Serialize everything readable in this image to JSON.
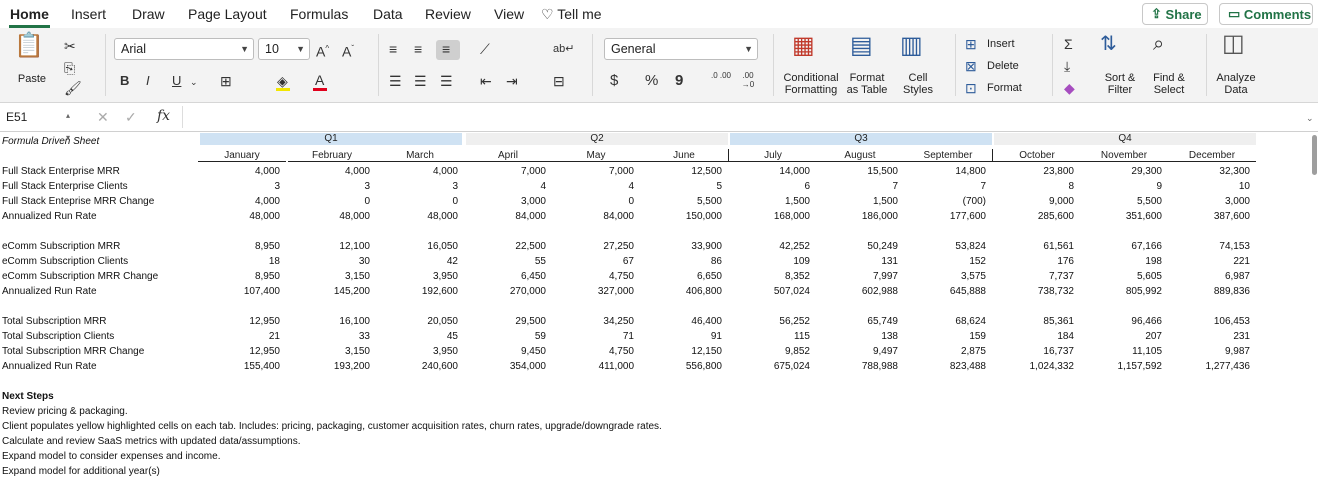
{
  "ribbon_tabs": [
    "Home",
    "Insert",
    "Draw",
    "Page Layout",
    "Formulas",
    "Data",
    "Review",
    "View",
    "Tell me"
  ],
  "share_label": "Share",
  "comments_label": "Comments",
  "clipboard": {
    "paste_label": "Paste"
  },
  "font": {
    "name": "Arial",
    "size": "10",
    "bold": "B",
    "italic": "I",
    "underline": "U"
  },
  "number": {
    "format": "General",
    "currency": "$",
    "percent": "%",
    "comma": "9",
    "inc_decimal": ".0 .00",
    "dec_decimal": ".00 →0"
  },
  "styles": {
    "conditional": "Conditional\nFormatting",
    "format_table": "Format\nas Table",
    "cell_styles": "Cell\nStyles"
  },
  "cells_group": {
    "insert": "Insert",
    "delete": "Delete",
    "format": "Format"
  },
  "editing": {
    "sort": "Sort &\nFilter",
    "find": "Find &\nSelect"
  },
  "analyze": {
    "label": "Analyze\nData"
  },
  "formula_bar": {
    "name_box": "E51",
    "fx": "fx",
    "content": ""
  },
  "sheet": {
    "title": "Formula Driven Sheet",
    "quarters": [
      "Q1",
      "Q2",
      "Q3",
      "Q4"
    ],
    "months": [
      "January",
      "February",
      "March",
      "April",
      "May",
      "June",
      "July",
      "August",
      "September",
      "October",
      "November",
      "December"
    ],
    "groups": [
      {
        "rows": [
          {
            "label": "Full Stack Enterprise MRR",
            "values": [
              "4,000",
              "4,000",
              "4,000",
              "7,000",
              "7,000",
              "12,500",
              "14,000",
              "15,500",
              "14,800",
              "23,800",
              "29,300",
              "32,300"
            ]
          },
          {
            "label": "Full Stack Enterprise Clients",
            "values": [
              "3",
              "3",
              "3",
              "4",
              "4",
              "5",
              "6",
              "7",
              "7",
              "8",
              "9",
              "10"
            ]
          },
          {
            "label": "Full Stack Enteprise MRR Change",
            "values": [
              "4,000",
              "0",
              "0",
              "3,000",
              "0",
              "5,500",
              "1,500",
              "1,500",
              "(700)",
              "9,000",
              "5,500",
              "3,000"
            ]
          },
          {
            "label": "Annualized Run Rate",
            "values": [
              "48,000",
              "48,000",
              "48,000",
              "84,000",
              "84,000",
              "150,000",
              "168,000",
              "186,000",
              "177,600",
              "285,600",
              "351,600",
              "387,600"
            ]
          }
        ]
      },
      {
        "rows": [
          {
            "label": "eComm Subscription MRR",
            "values": [
              "8,950",
              "12,100",
              "16,050",
              "22,500",
              "27,250",
              "33,900",
              "42,252",
              "50,249",
              "53,824",
              "61,561",
              "67,166",
              "74,153"
            ]
          },
          {
            "label": "eComm Subscription Clients",
            "values": [
              "18",
              "30",
              "42",
              "55",
              "67",
              "86",
              "109",
              "131",
              "152",
              "176",
              "198",
              "221"
            ]
          },
          {
            "label": "eComm Subscription MRR Change",
            "values": [
              "8,950",
              "3,150",
              "3,950",
              "6,450",
              "4,750",
              "6,650",
              "8,352",
              "7,997",
              "3,575",
              "7,737",
              "5,605",
              "6,987"
            ]
          },
          {
            "label": "Annualized Run Rate",
            "values": [
              "107,400",
              "145,200",
              "192,600",
              "270,000",
              "327,000",
              "406,800",
              "507,024",
              "602,988",
              "645,888",
              "738,732",
              "805,992",
              "889,836"
            ]
          }
        ]
      },
      {
        "rows": [
          {
            "label": "Total Subscription MRR",
            "values": [
              "12,950",
              "16,100",
              "20,050",
              "29,500",
              "34,250",
              "46,400",
              "56,252",
              "65,749",
              "68,624",
              "85,361",
              "96,466",
              "106,453"
            ]
          },
          {
            "label": "Total Subscription Clients",
            "values": [
              "21",
              "33",
              "45",
              "59",
              "71",
              "91",
              "115",
              "138",
              "159",
              "184",
              "207",
              "231"
            ]
          },
          {
            "label": "Total Subscription MRR Change",
            "values": [
              "12,950",
              "3,150",
              "3,950",
              "9,450",
              "4,750",
              "12,150",
              "9,852",
              "9,497",
              "2,875",
              "16,737",
              "11,105",
              "9,987"
            ]
          },
          {
            "label": "Annualized Run Rate",
            "values": [
              "155,400",
              "193,200",
              "240,600",
              "354,000",
              "411,000",
              "556,800",
              "675,024",
              "788,988",
              "823,488",
              "1,024,332",
              "1,157,592",
              "1,277,436"
            ]
          }
        ]
      }
    ],
    "next_steps_title": "Next Steps",
    "next_steps": [
      "Review pricing & packaging.",
      "Client populates yellow highlighted cells on each tab. Includes: pricing, packaging, customer acquisition rates, churn rates, upgrade/downgrade rates.",
      "Calculate and review SaaS metrics with updated data/assumptions.",
      "Expand model to consider expenses and income.",
      "Expand model for additional year(s)"
    ]
  },
  "colors": {
    "accent": "#217346",
    "q_blue": "#cfe2f3",
    "q_gray": "#efefef"
  }
}
